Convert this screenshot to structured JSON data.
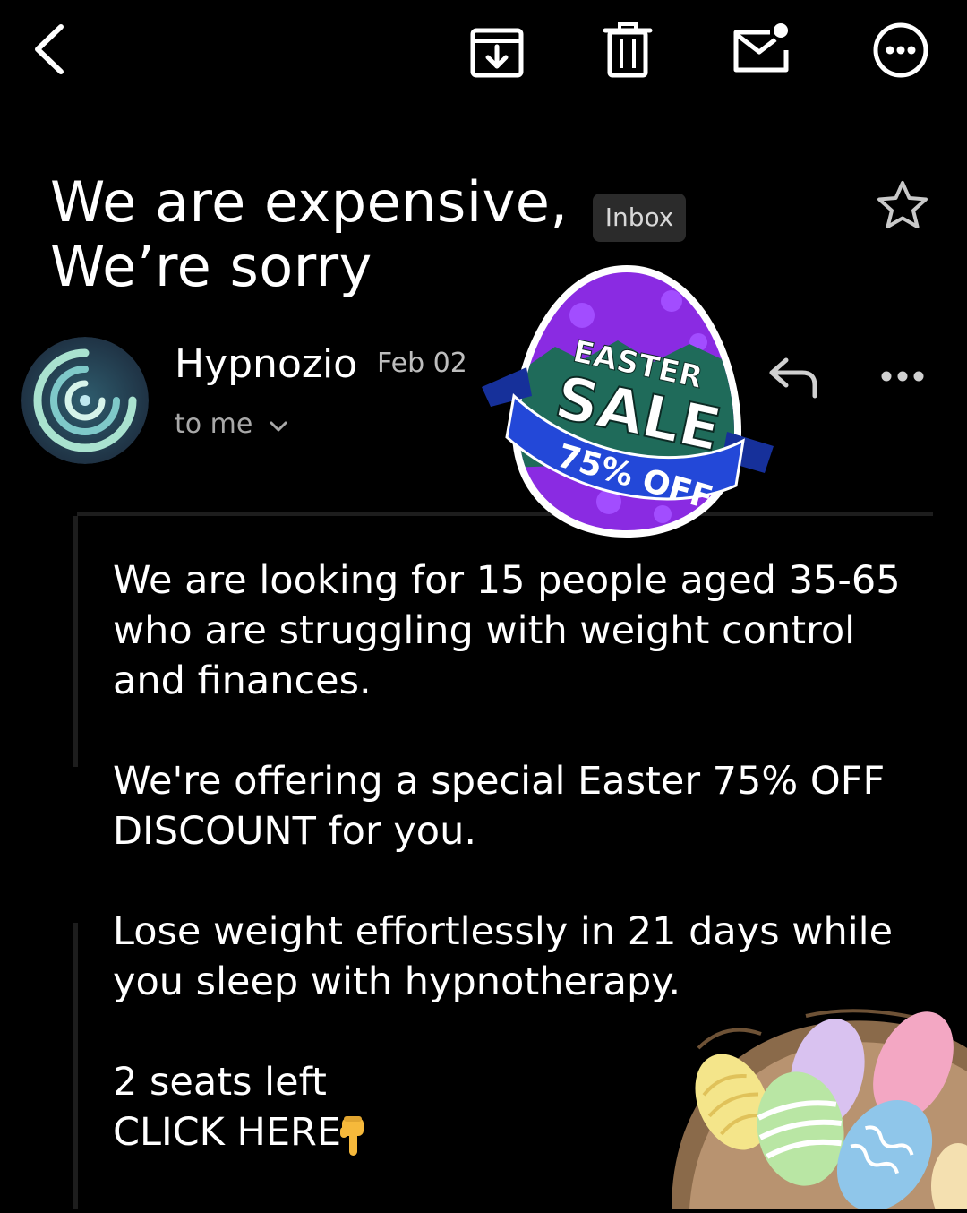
{
  "toolbar": {
    "back_icon": "chevron-left-icon",
    "archive_icon": "archive-down-icon",
    "delete_icon": "trash-icon",
    "mark_unread_icon": "mail-unread-icon",
    "more_icon": "more-circle-icon"
  },
  "email": {
    "subject": "We are expensive, We’re sorry",
    "label": "Inbox",
    "starred": false,
    "sender": "Hypnozio",
    "date": "Feb 02",
    "recipient": "to me",
    "body": [
      "We are looking for 15 people aged 35-65 who are struggling with weight control and finances.",
      "We're offering a special Easter 75% OFF DISCOUNT for you.",
      "Lose weight effortlessly in 21 days while you sleep with hypnotherapy.",
      "2 seats left"
    ],
    "cta": "CLICK HERE"
  },
  "sale_badge": {
    "line1": "EASTER",
    "line2": "SALE",
    "line3": "75% OFF"
  },
  "colors": {
    "background": "#000000",
    "text": "#ffffff",
    "muted": "#a8a8a8",
    "badge_bg": "#2b2b2b",
    "egg_purple": "#8a2be2",
    "egg_green": "#1f6b5a",
    "ribbon_blue": "#1e3ab8"
  }
}
